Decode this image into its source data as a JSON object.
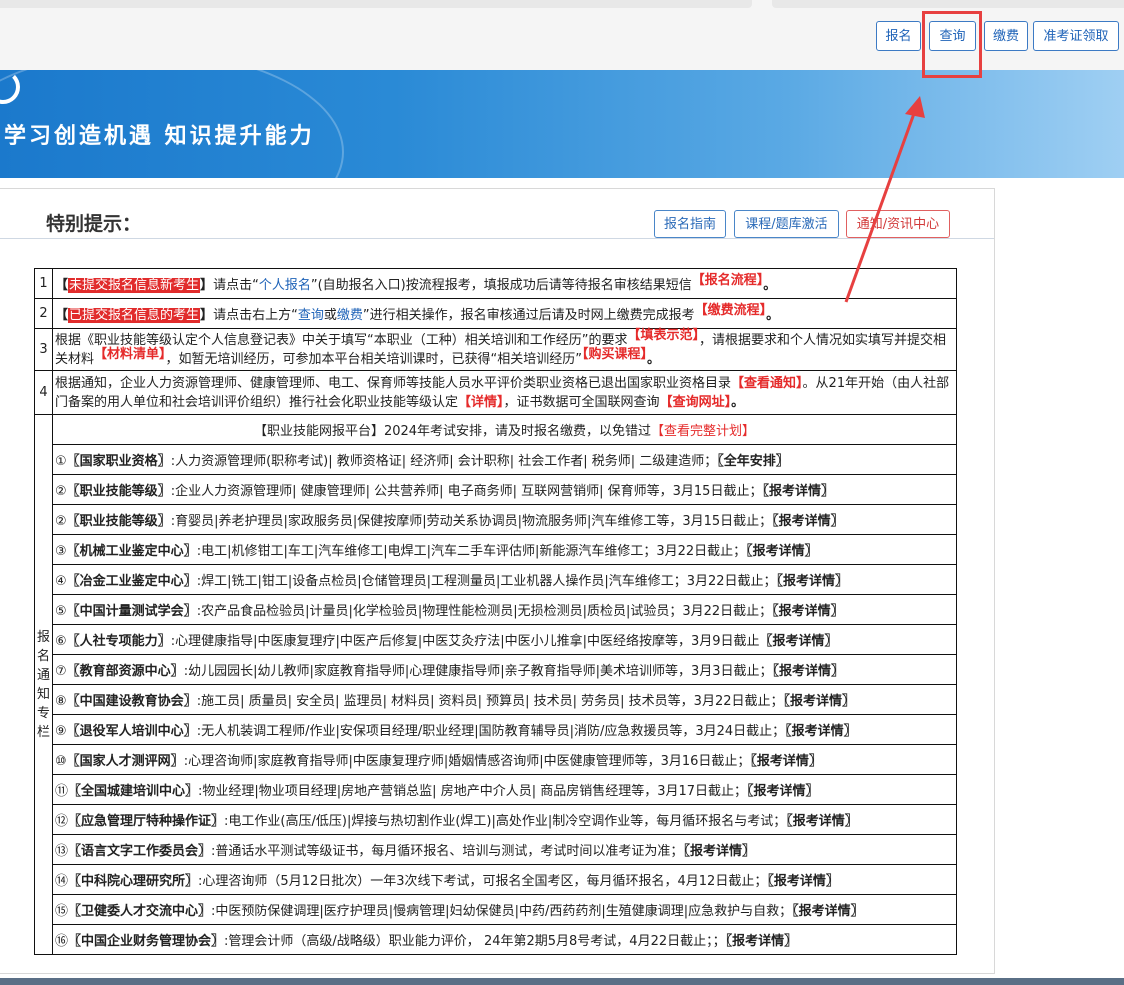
{
  "top_nav": {
    "buttons": [
      "报名",
      "查询",
      "缴费",
      "准考证领取"
    ]
  },
  "banner": {
    "slogan": "学习创造机遇  知识提升能力"
  },
  "panel": {
    "title": "特别提示：",
    "buttons": [
      "报名指南",
      "课程/题库激活",
      "通知/资讯中心"
    ]
  },
  "notices": {
    "n1": "1",
    "n2": "2",
    "n3": "3",
    "n4": "4",
    "r1_bracket_l": "【",
    "r1_tag": "未提交报名信息新考生",
    "r1_bracket_r": "】",
    "r1_a": "请点击“",
    "r1_link": "个人报名",
    "r1_b": "”(自助报名入口)按流程报考，填报成功后请等待报名审核结果短信",
    "r1_c": "【报名流程】",
    "r1_end": "。",
    "r2_bracket_l": "【",
    "r2_tag": "已提交报名信息的考生",
    "r2_bracket_r": "】",
    "r2_a": "请点击右上方“",
    "r2_link1": "查询",
    "r2_or": "或",
    "r2_link2": "缴费",
    "r2_b": "”进行相关操作，报名审核通过后请及时网上缴费完成报考",
    "r2_c": "【缴费流程】",
    "r2_end": "。",
    "r3_a": "根据《职业技能等级认定个人信息登记表》中关于填写“本职业（工种）相关培训和工作经历”的要求",
    "r3_l1": "【填表示范】",
    "r3_b": "，请根据要求和个人情况如实填写并提交相关材料",
    "r3_l2": "【材料清单】",
    "r3_c": "，如暂无培训经历，可参加本平台相关培训课时，已获得“相关培训经历”",
    "r3_l3": "【购买课程】",
    "r3_end": "。",
    "r4_a": "根据通知，企业人力资源管理师、健康管理师、电工、保育师等技能人员水平评价类职业资格已退出国家职业资格目录",
    "r4_l1": "【查看通知】",
    "r4_b": "。从21年开始（由人社部门备案的用人单位和社会培训评价组织）推行社会化职业技能等级认定",
    "r4_l2": "【详情】",
    "r4_c": "，证书数据可全国联网查询",
    "r4_l3": "【查询网址】",
    "r4_end": "。"
  },
  "column": {
    "side_label": [
      "报",
      "名",
      "通",
      "知",
      "专",
      "栏"
    ],
    "header_a": "【职业技能网报平台】2024年考试安排，请及时报名缴费，以免错过",
    "header_link": "【查看完整计划】",
    "items": [
      {
        "num": "①",
        "org": "〖国家职业资格〗",
        "text": ":人力资源管理师(职称考试)| 教师资格证| 经济师| 会计职称| 社会工作者|  税务师| 二级建造师；",
        "link": "〖全年安排〗"
      },
      {
        "num": "②",
        "org": "〖职业技能等级〗",
        "text": ":企业人力资源管理师| 健康管理师| 公共营养师| 电子商务师| 互联网营销师| 保育师等，3月15日截止；",
        "link": "〖报考详情〗"
      },
      {
        "num": "②",
        "org": "〖职业技能等级〗",
        "text": ":育婴员|养老护理员|家政服务员|保健按摩师|劳动关系协调员|物流服务师|汽车维修工等，3月15日截止；",
        "link": "〖报考详情〗"
      },
      {
        "num": "③",
        "org": "〖机械工业鉴定中心〗",
        "text": ":电工|机修钳工|车工|汽车维修工|电焊工|汽车二手车评估师|新能源汽车维修工；3月22日截止；",
        "link": "〖报考详情〗"
      },
      {
        "num": "④",
        "org": "〖冶金工业鉴定中心〗",
        "text": ":焊工|铣工|钳工|设备点检员|仓储管理员|工程测量员|工业机器人操作员|汽车维修工；3月22日截止；",
        "link": "〖报考详情〗"
      },
      {
        "num": "⑤",
        "org": "〖中国计量测试学会〗",
        "text": ":农产品食品检验员|计量员|化学检验员|物理性能检测员|无损检测员|质检员|试验员；3月22日截止；",
        "link": "〖报考详情〗"
      },
      {
        "num": "⑥",
        "org": "〖人社专项能力〗",
        "text": ":心理健康指导|中医康复理疗|中医产后修复|中医艾灸疗法|中医小儿推拿|中医经络按摩等，3月9日截止",
        "link": "〖报考详情〗"
      },
      {
        "num": "⑦",
        "org": "〖教育部资源中心〗",
        "text": ":幼儿园园长|幼儿教师|家庭教育指导师|心理健康指导师|亲子教育指导师|美术培训师等，3月3日截止；",
        "link": "〖报考详情〗"
      },
      {
        "num": "⑧",
        "org": "〖中国建设教育协会〗",
        "text": ":施工员| 质量员| 安全员| 监理员| 材料员| 资料员| 预算员| 技术员| 劳务员| 技术员等，3月22日截止；",
        "link": "〖报考详情〗"
      },
      {
        "num": "⑨",
        "org": "〖退役军人培训中心〗",
        "text": ":无人机装调工程师/作业|安保项目经理/职业经理|国防教育辅导员|消防/应急救援员等，3月24日截止；",
        "link": "〖报考详情〗"
      },
      {
        "num": "⑩",
        "org": "〖国家人才测评网〗",
        "text": ":心理咨询师|家庭教育指导师|中医康复理疗师|婚姻情感咨询师|中医健康管理师等，3月16日截止；",
        "link": "〖报考详情〗"
      },
      {
        "num": "⑪",
        "org": "〖全国城建培训中心〗",
        "text": ":物业经理|物业项目经理|房地产营销总监| 房地产中介人员| 商品房销售经理等，3月17日截止；",
        "link": "〖报考详情〗"
      },
      {
        "num": "⑫",
        "org": "〖应急管理厅特种操作证〗",
        "text": ":电工作业(高压/低压)|焊接与热切割作业(焊工)|高处作业|制冷空调作业等，每月循环报名与考试；",
        "link": "〖报考详情〗"
      },
      {
        "num": "⑬",
        "org": "〖语言文字工作委员会〗",
        "text": ":普通话水平测试等级证书，每月循环报名、培训与测试，考试时间以准考证为准；",
        "link": "〖报考详情〗"
      },
      {
        "num": "⑭",
        "org": "〖中科院心理研究所〗",
        "text": ":心理咨询师（5月12日批次）一年3次线下考试，可报名全国考区，每月循环报名，4月12日截止；",
        "link": "〖报考详情〗"
      },
      {
        "num": "⑮",
        "org": "〖卫健委人才交流中心〗",
        "text": ":中医预防保健调理|医疗护理员|慢病管理|妇幼保健员|中药/西药药剂|生殖健康调理|应急救护与自救；",
        "link": "〖报考详情〗"
      },
      {
        "num": "⑯",
        "org": "〖中国企业财务管理协会〗",
        "text": ":管理会计师（高级/战略级）职业能力评价， 24年第2期5月8号考试，4月22日截止；；",
        "link": "〖报考详情〗"
      }
    ]
  },
  "colors": {
    "accent_blue": "#1f63b8",
    "highlight_red": "#e52b2b",
    "annotation_red": "#e74040"
  }
}
